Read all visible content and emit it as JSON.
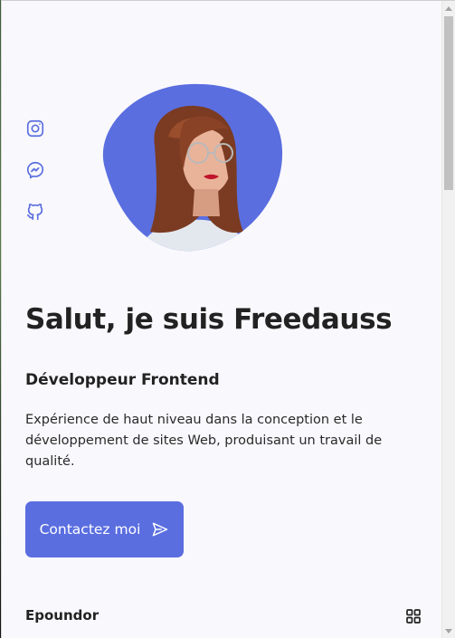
{
  "social": {
    "links": [
      {
        "icon": "instagram-icon"
      },
      {
        "icon": "messenger-icon"
      },
      {
        "icon": "github-icon"
      }
    ]
  },
  "hero": {
    "title": "Salut, je suis Freedauss",
    "subtitle": "Développeur Frontend",
    "description": "Expérience de haut niveau dans la conception et le développement de sites Web, produisant un travail de qualité.",
    "contact_label": "Contactez moi",
    "contact_icon": "send-icon"
  },
  "footer": {
    "brand": "Epoundor",
    "menu_icon": "grid-menu-icon"
  },
  "colors": {
    "accent": "#5a6ee0",
    "background": "#f9f8fc",
    "text": "#222222"
  }
}
